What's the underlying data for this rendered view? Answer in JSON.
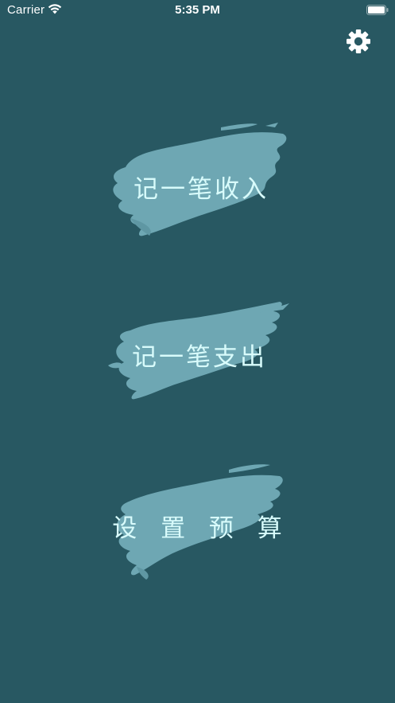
{
  "status_bar": {
    "carrier": "Carrier",
    "time": "5:35 PM",
    "wifi_icon": "wifi-icon",
    "battery_icon": "battery-icon"
  },
  "header": {
    "settings_icon": "gear-icon"
  },
  "actions": {
    "income_label": "记一笔收入",
    "expense_label": "记一笔支出",
    "budget_label": "设 置 预 算"
  },
  "colors": {
    "background": "#285862",
    "brush": "#6ea7b3",
    "label": "#d8fbfb",
    "status_text": "#ffffff"
  }
}
